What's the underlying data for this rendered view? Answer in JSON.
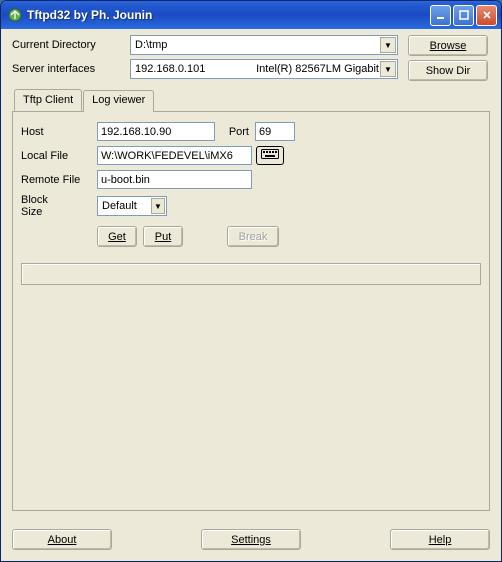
{
  "window": {
    "title": "Tftpd32 by Ph. Jounin"
  },
  "top": {
    "current_directory_label": "Current Directory",
    "current_directory_value": "D:\\tmp",
    "server_interfaces_label": "Server interfaces",
    "server_interfaces_ip": "192.168.0.101",
    "server_interfaces_adapter": "Intel(R) 82567LM Gigabit",
    "browse_label": "Browse",
    "showdir_label": "Show Dir"
  },
  "tabs": {
    "active": "Tftp Client",
    "items": [
      "Tftp Client",
      "Log viewer"
    ]
  },
  "tftp_client": {
    "host_label": "Host",
    "host_value": "192.168.10.90",
    "port_label": "Port",
    "port_value": "69",
    "local_file_label": "Local File",
    "local_file_value": "W:\\WORK\\FEDEVEL\\iMX6",
    "remote_file_label": "Remote File",
    "remote_file_value": "u-boot.bin",
    "block_size_label_line1": "Block",
    "block_size_label_line2": "Size",
    "block_size_value": "Default",
    "get_label": "Get",
    "put_label": "Put",
    "break_label": "Break"
  },
  "bottom": {
    "about_label": "About",
    "settings_label": "Settings",
    "help_label": "Help"
  }
}
